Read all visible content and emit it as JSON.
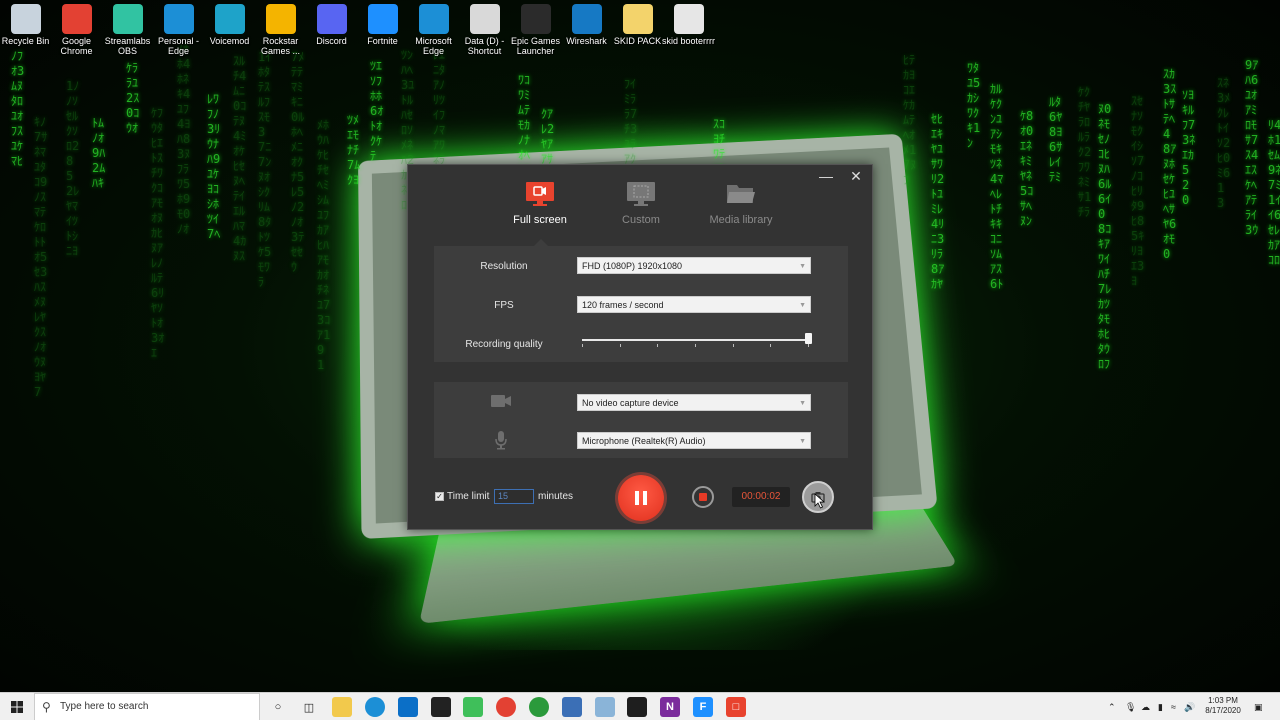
{
  "desktop": {
    "icons": [
      {
        "label": "Recycle Bin",
        "icon": "recycle-bin-icon",
        "color": "#c8d3dd"
      },
      {
        "label": "Google Chrome",
        "icon": "chrome-icon",
        "color": "#e34133"
      },
      {
        "label": "Streamlabs OBS",
        "icon": "streamlabs-icon",
        "color": "#31c3a2"
      },
      {
        "label": "Personal - Edge",
        "icon": "edge-icon",
        "color": "#1c8fd6"
      },
      {
        "label": "Voicemod",
        "icon": "voicemod-icon",
        "color": "#1ea3c9"
      },
      {
        "label": "Rockstar Games ...",
        "icon": "rockstar-icon",
        "color": "#f4b400"
      },
      {
        "label": "Discord",
        "icon": "discord-icon",
        "color": "#5865f2"
      },
      {
        "label": "Fortnite",
        "icon": "fortnite-icon",
        "color": "#1e90ff"
      },
      {
        "label": "Microsoft Edge",
        "icon": "edge-icon",
        "color": "#1c8fd6"
      },
      {
        "label": "Data (D) - Shortcut",
        "icon": "drive-icon",
        "color": "#d9d9d9"
      },
      {
        "label": "Epic Games Launcher",
        "icon": "epic-games-icon",
        "color": "#2b2b2b"
      },
      {
        "label": "Wireshark",
        "icon": "wireshark-icon",
        "color": "#1679c4"
      },
      {
        "label": "SKID PACK",
        "icon": "folder-zip-icon",
        "color": "#f3d36b"
      },
      {
        "label": "skid booterrrr",
        "icon": "app-icon",
        "color": "#e6e6e6"
      }
    ]
  },
  "recorder": {
    "tabs": [
      {
        "label": "Full screen",
        "active": true
      },
      {
        "label": "Custom",
        "active": false
      },
      {
        "label": "Media library",
        "active": false
      }
    ],
    "accent": "#e8432e",
    "settings": {
      "resolution_label": "Resolution",
      "resolution_value": "FHD (1080P)   1920x1080",
      "fps_label": "FPS",
      "fps_value": "120 frames / second",
      "quality_label": "Recording quality",
      "quality_level": 1.0
    },
    "devices": {
      "camera_value": "No video capture device",
      "mic_value": "Microphone (Realtek(R) Audio)"
    },
    "bottom": {
      "time_limit_label": "Time limit",
      "time_limit_checked": true,
      "time_limit_value": "15",
      "minutes_label": "minutes",
      "timer": "00:00:02"
    }
  },
  "taskbar": {
    "search_placeholder": "Type here to search",
    "time": "1:03 PM",
    "date": "8/17/2020"
  }
}
